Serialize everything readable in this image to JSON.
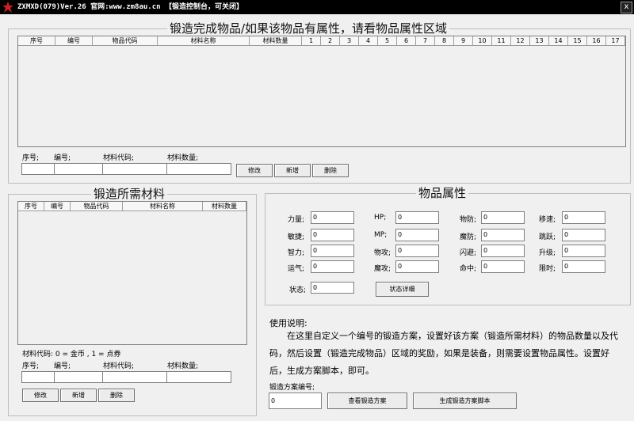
{
  "window": {
    "title": "ZXMXD(079)Ver.26 官网:www.zm8au.cn 【锻造控制台，可关闭】",
    "close_label": "x"
  },
  "finished": {
    "legend": "锻造完成物品/如果该物品有属性，请看物品属性区域",
    "columns": [
      "序号",
      "编号",
      "物品代码",
      "材料名称",
      "材料数量",
      "1",
      "2",
      "3",
      "4",
      "5",
      "6",
      "7",
      "8",
      "9",
      "10",
      "11",
      "12",
      "13",
      "14",
      "15",
      "16",
      "17"
    ],
    "label_seq": "序号;",
    "label_id": "编号;",
    "label_code": "材料代码;",
    "label_qty": "材料数量;",
    "seq_value": "",
    "id_value": "",
    "code_value": "",
    "qty_value": "",
    "btn_edit": "修改",
    "btn_add": "新增",
    "btn_delete": "删除"
  },
  "materials": {
    "legend": "锻造所需材料",
    "columns": [
      "序号",
      "编号",
      "物品代码",
      "材料名称",
      "材料数量"
    ],
    "hint": "材料代码: 0 = 金币 , 1 = 点券",
    "label_seq": "序号;",
    "label_id": "编号;",
    "label_code": "材料代码;",
    "label_qty": "材料数量;",
    "seq_value": "",
    "id_value": "",
    "code_value": "",
    "qty_value": "",
    "btn_edit": "修改",
    "btn_add": "新增",
    "btn_delete": "删除"
  },
  "attributes": {
    "legend": "物品属性",
    "fields": [
      {
        "label": "力量;",
        "value": "0"
      },
      {
        "label": "HP;",
        "value": "0"
      },
      {
        "label": "物防;",
        "value": "0"
      },
      {
        "label": "移速;",
        "value": "0"
      },
      {
        "label": "敏捷;",
        "value": "0"
      },
      {
        "label": "MP;",
        "value": "0"
      },
      {
        "label": "魔防;",
        "value": "0"
      },
      {
        "label": "跳跃;",
        "value": "0"
      },
      {
        "label": "智力;",
        "value": "0"
      },
      {
        "label": "物攻;",
        "value": "0"
      },
      {
        "label": "闪避;",
        "value": "0"
      },
      {
        "label": "升级;",
        "value": "0"
      },
      {
        "label": "运气;",
        "value": "0"
      },
      {
        "label": "魔攻;",
        "value": "0"
      },
      {
        "label": "命中;",
        "value": "0"
      },
      {
        "label": "限时;",
        "value": "0"
      }
    ],
    "status_label": "状态;",
    "status_value": "0",
    "status_button": "状态详细"
  },
  "help": {
    "title": "使用说明:",
    "text": "在这里自定义一个编号的锻造方案，设置好该方案（锻造所需材料）的物品数量以及代码，然后设置（锻造完成物品）区域的奖励，如果是装备，则需要设置物品属性。设置好后，生成方案脚本，即可。"
  },
  "plan": {
    "label": "锻造方案编号;",
    "value": "0",
    "view_button": "查看锻造方案",
    "generate_button": "生成锻造方案脚本"
  }
}
